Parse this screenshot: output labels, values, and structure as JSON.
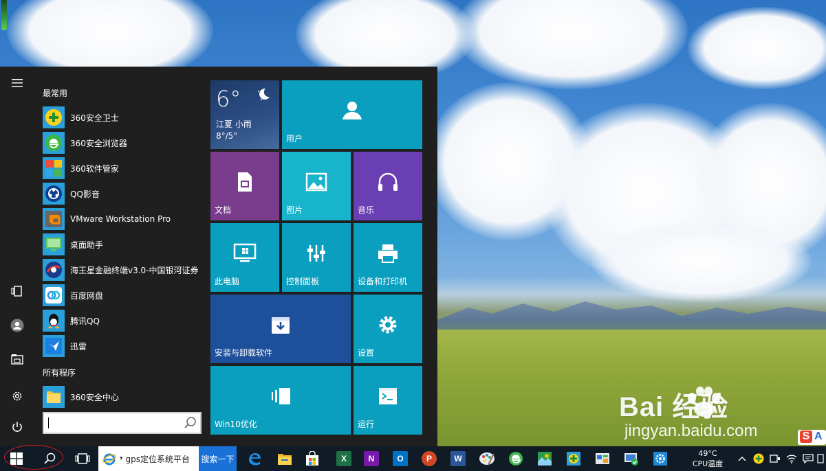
{
  "start_menu": {
    "frequent_title": "最常用",
    "frequent_apps": [
      {
        "label": "360安全卫士",
        "icon": "360-safe-guard-icon"
      },
      {
        "label": "360安全浏览器",
        "icon": "360-browser-icon"
      },
      {
        "label": "360软件管家",
        "icon": "360-software-manager-icon"
      },
      {
        "label": "QQ影音",
        "icon": "qq-player-icon"
      },
      {
        "label": "VMware Workstation Pro",
        "icon": "vmware-icon"
      },
      {
        "label": "桌面助手",
        "icon": "desktop-assistant-icon"
      },
      {
        "label": "海王星金融终端v3.0-中国银河证券",
        "icon": "neptune-finance-icon"
      },
      {
        "label": "百度网盘",
        "icon": "baidu-netdisk-icon"
      },
      {
        "label": "腾讯QQ",
        "icon": "tencent-qq-icon"
      },
      {
        "label": "迅雷",
        "icon": "xunlei-icon"
      }
    ],
    "all_programs_title": "所有程序",
    "all_programs": [
      {
        "label": "360安全中心",
        "icon": "folder-icon"
      }
    ],
    "search_placeholder": ""
  },
  "tiles": {
    "weather": {
      "temp": "6°",
      "city": "江夏  小雨",
      "range": "8°/5°"
    },
    "user": "用户",
    "documents": "文档",
    "pictures": "图片",
    "music": "音乐",
    "this_pc": "此电脑",
    "control_panel": "控制面板",
    "devices_printers": "设备和打印机",
    "install_uninstall": "安装与卸载软件",
    "settings": "设置",
    "win10_optimize": "Win10优化",
    "run": "运行"
  },
  "taskbar": {
    "ie_window_title": "gps定位系统平台",
    "search_button": "搜索一下",
    "apps": [
      {
        "name": "edge-icon",
        "label": "e"
      },
      {
        "name": "file-explorer-icon",
        "label": ""
      },
      {
        "name": "store-icon",
        "label": ""
      },
      {
        "name": "excel-icon",
        "label": "X"
      },
      {
        "name": "onenote-icon",
        "label": "N"
      },
      {
        "name": "outlook-icon",
        "label": "O"
      },
      {
        "name": "powerpoint-icon",
        "label": "P"
      },
      {
        "name": "word-icon",
        "label": "W"
      },
      {
        "name": "paint-icon",
        "label": ""
      },
      {
        "name": "360-browser-taskbar-icon",
        "label": "e"
      },
      {
        "name": "map-app-icon",
        "label": ""
      },
      {
        "name": "360-security-center-icon",
        "label": ""
      },
      {
        "name": "sound-card-icon",
        "label": ""
      },
      {
        "name": "remote-desktop-icon",
        "label": ""
      },
      {
        "name": "settings-taskbar-icon",
        "label": ""
      }
    ],
    "cpu_temp": "49°C",
    "cpu_label": "CPU温度"
  },
  "watermark": {
    "brand": "Bai  经验",
    "url": "jingyan.baidu.com"
  },
  "ime": {
    "s": "S",
    "a": "A"
  },
  "colors": {
    "start_bg": "#1f1f1f",
    "tile_cyan": "#0a9fbf",
    "tile_purple_docs": "#7a3c8c",
    "tile_purple_music": "#6a3fb3",
    "tile_blue_install": "#1e4f9a",
    "taskbar_bg": "#101b25"
  }
}
